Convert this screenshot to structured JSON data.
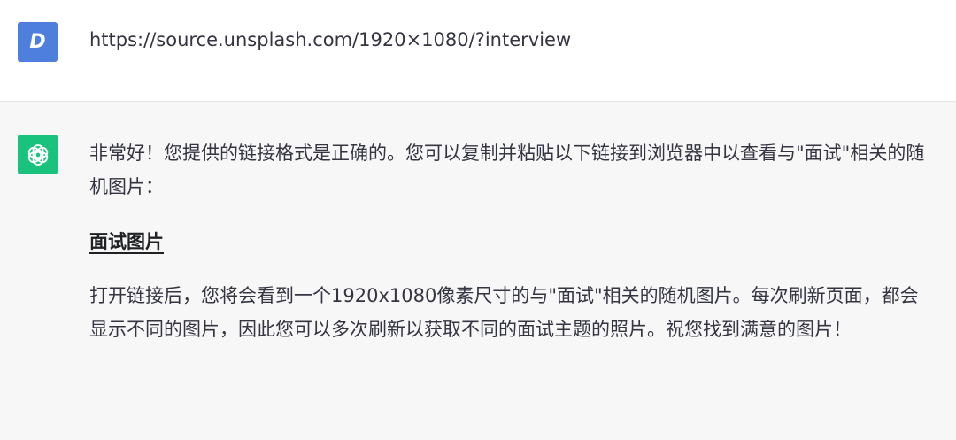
{
  "user_message": {
    "avatar_letter": "D",
    "text": "https://source.unsplash.com/1920×1080/?interview"
  },
  "assistant_message": {
    "avatar_icon": "openai-logo-icon",
    "intro": "非常好！您提供的链接格式是正确的。您可以复制并粘贴以下链接到浏览器中以查看与\"面试\"相关的随机图片：",
    "link_label": "面试图片",
    "outro": "打开链接后，您将会看到一个1920x1080像素尺寸的与\"面试\"相关的随机图片。每次刷新页面，都会显示不同的图片，因此您可以多次刷新以获取不同的面试主题的照片。祝您找到满意的图片！"
  },
  "colors": {
    "user_avatar": "#4f7fdc",
    "assistant_avatar": "#19c37d",
    "assistant_bg": "#f7f7f8"
  }
}
